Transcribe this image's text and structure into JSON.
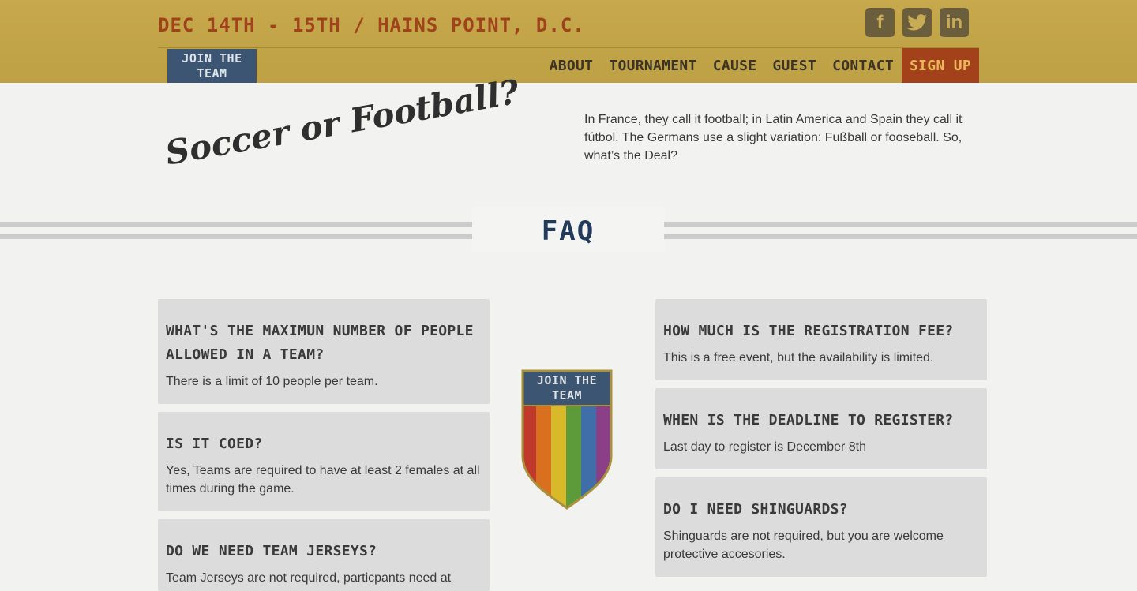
{
  "header": {
    "event_line": "DEC 14TH - 15TH / HAINS POINT, D.C.",
    "logo_line1": "JOIN THE",
    "logo_line2": "TEAM",
    "social": [
      {
        "icon": "facebook-icon",
        "glyph": "f"
      },
      {
        "icon": "twitter-icon",
        "glyph": "t"
      },
      {
        "icon": "linkedin-icon",
        "glyph": "in"
      }
    ],
    "nav": [
      "ABOUT",
      "TOURNAMENT",
      "CAUSE",
      "GUEST",
      "CONTACT"
    ],
    "signup": "SIGN UP"
  },
  "intro": {
    "title": "Soccer or Football?",
    "text": "In France, they call it football; in Latin America and Spain they call it fútbol. The Germans use a slight variation: Fußball or fooseball. So, what’s the Deal?"
  },
  "faq": {
    "title": "FAQ",
    "badge_line1": "JOIN THE",
    "badge_line2": "TEAM",
    "left": [
      {
        "q": "WHAT'S THE MAXIMUN NUMBER OF PEOPLE ALLOWED IN A TEAM?",
        "a": "There is a limit of 10 people per team."
      },
      {
        "q": "IS IT COED?",
        "a": "Yes, Teams are required to have at least 2 females at all times during the game."
      },
      {
        "q": "DO WE NEED TEAM JERSEYS?",
        "a": "Team Jerseys are not required, particpants need at"
      }
    ],
    "right": [
      {
        "q": "HOW MUCH IS THE REGISTRATION FEE?",
        "a": "This is a free event, but the availability is limited."
      },
      {
        "q": "WHEN IS THE DEADLINE TO REGISTER?",
        "a": "Last day to register is December 8th"
      },
      {
        "q": "DO I NEED SHINGUARDS?",
        "a": "Shinguards are not required, but you are welcome protective accesories."
      }
    ]
  },
  "colors": {
    "header_bg": "#c2a44a",
    "accent_orange": "#a3411b",
    "navy": "#233a5a",
    "card_bg": "#dcdcdc"
  }
}
